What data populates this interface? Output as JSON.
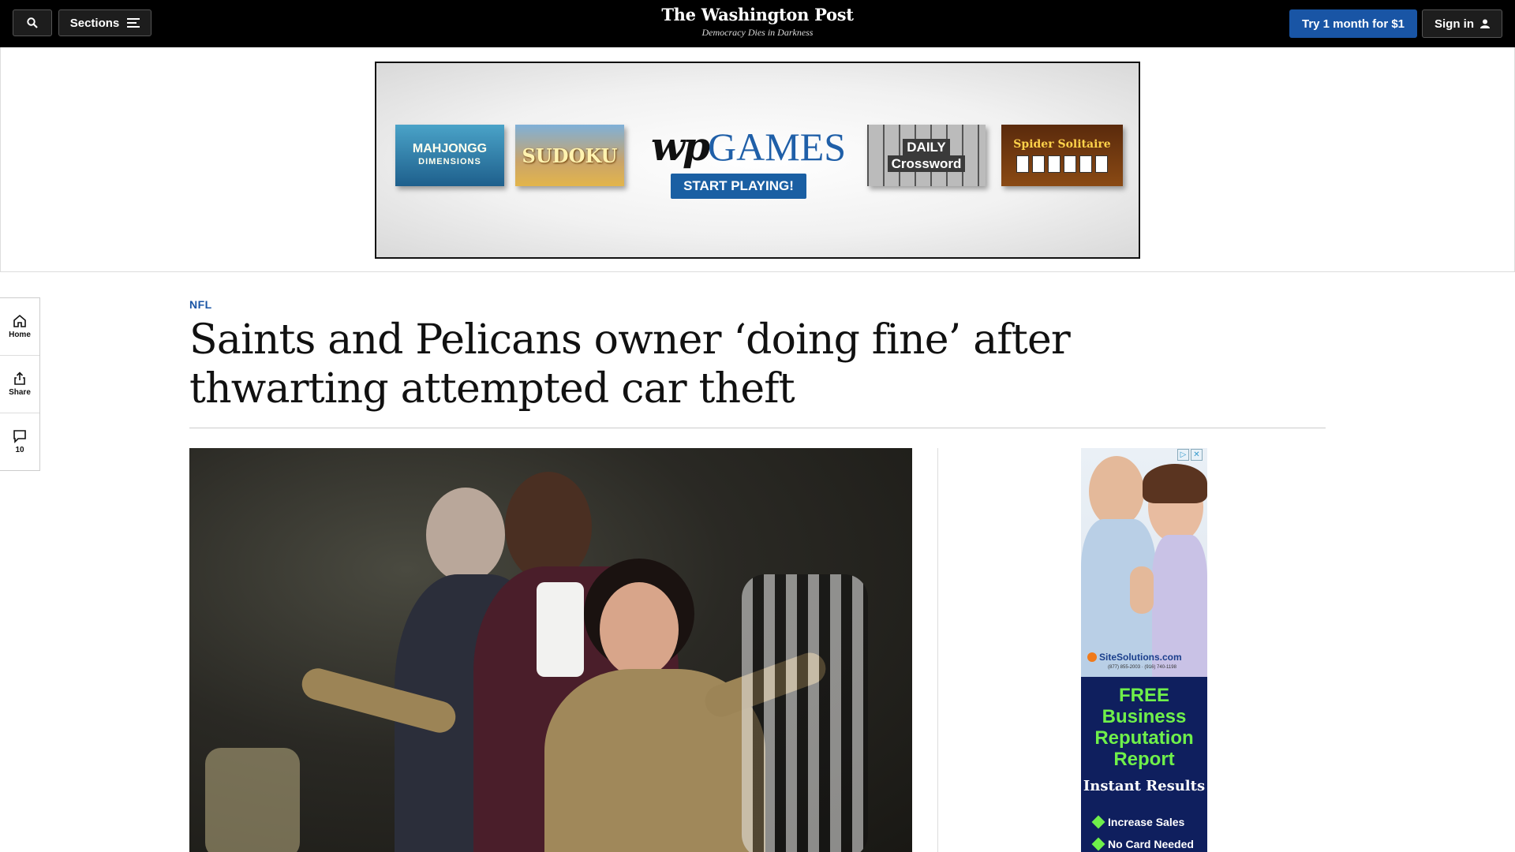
{
  "header": {
    "sections_label": "Sections",
    "logo": "The Washington Post",
    "tagline": "Democracy Dies in Darkness",
    "trial_label": "Try 1 month for $1",
    "signin_label": "Sign in",
    "accent_color": "#1955a5"
  },
  "banner_ad": {
    "tiles": {
      "mahjongg_line1": "MAHJONGG",
      "mahjongg_line2": "DIMENSIONS",
      "sudoku": "SUDOKU",
      "crossword_line1": "DAILY",
      "crossword_line2": "Crossword",
      "solitaire": "Spider Solitaire"
    },
    "brand_wp": "wp",
    "brand_games": "GAMES",
    "cta": "START PLAYING!"
  },
  "rail": {
    "home": "Home",
    "share": "Share",
    "comments_count": "10"
  },
  "article": {
    "kicker": "NFL",
    "headline": "Saints and Pelicans owner ‘doing fine’ after thwarting attempted car theft"
  },
  "side_ad": {
    "brand": "SiteSolutions.com",
    "phone": "(877) 855-2003 · (916) 740-1198",
    "free_lines": [
      "FREE",
      "Business",
      "Reputation",
      "Report"
    ],
    "instant": "Instant Results",
    "bullets": [
      "Increase Sales",
      "No Card Needed"
    ]
  }
}
